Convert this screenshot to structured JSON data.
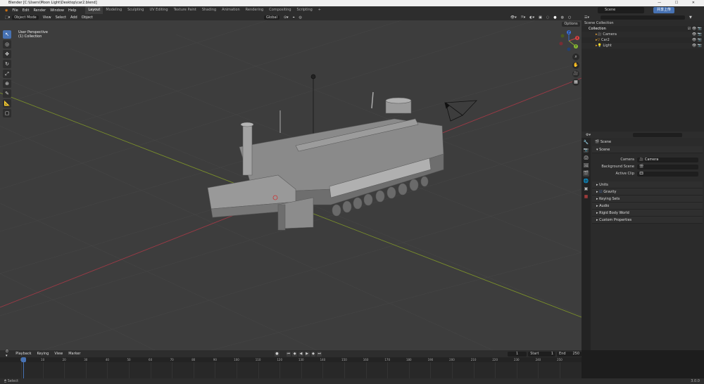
{
  "titlebar": {
    "title": "Blender [C:\\Users\\Moon Light\\Desktop\\car2.blend]"
  },
  "menus": [
    "File",
    "Edit",
    "Render",
    "Window",
    "Help"
  ],
  "workspaces": [
    "Layout",
    "Modeling",
    "Sculpting",
    "UV Editing",
    "Texture Paint",
    "Shading",
    "Animation",
    "Rendering",
    "Compositing",
    "Scripting"
  ],
  "scene_name": "Scene",
  "upload_label": "共享上传",
  "viewport_header": {
    "mode": "Object Mode",
    "menus": [
      "View",
      "Select",
      "Add",
      "Object"
    ],
    "transform": "Global",
    "options": "Options"
  },
  "viewport_info": {
    "line1": "User Perspective",
    "line2": "(1) Collection"
  },
  "gizmo": {
    "x": "X",
    "y": "Y",
    "z": "Z"
  },
  "outliner": {
    "rows": [
      {
        "label": "Scene Collection",
        "indent": 0,
        "vis": ""
      },
      {
        "label": "Collection",
        "indent": 1,
        "vis": "☑ 👁 📷"
      },
      {
        "label": "Camera",
        "indent": 2,
        "vis": "👁 📷"
      },
      {
        "label": "Car2",
        "indent": 2,
        "vis": "👁 📷"
      },
      {
        "label": "Light",
        "indent": 2,
        "vis": "👁 📷"
      }
    ]
  },
  "properties": {
    "context": "Scene",
    "panels": {
      "scene": "Scene",
      "units": "Units",
      "gravity": "Gravity",
      "keying_sets": "Keying Sets",
      "audio": "Audio",
      "rigid_body": "Rigid Body World",
      "custom": "Custom Properties"
    },
    "camera_label": "Camera",
    "camera_value": "Camera",
    "background_label": "Background Scene",
    "active_clip_label": "Active Clip"
  },
  "timeline": {
    "menus": [
      "Playback",
      "Keying",
      "View",
      "Marker"
    ],
    "current_frame": "1",
    "start_label": "Start",
    "start": "1",
    "end_label": "End",
    "end": "250",
    "ticks": [
      0,
      10,
      20,
      30,
      40,
      50,
      60,
      70,
      80,
      90,
      100,
      110,
      120,
      130,
      140,
      150,
      160,
      170,
      180,
      190,
      200,
      210,
      220,
      230,
      240,
      250
    ],
    "playhead_frame": 1
  },
  "status": {
    "left": "Select",
    "right": "3.0.0"
  },
  "colors": {
    "accent": "#4772b3",
    "x_axis": "#9c3a46",
    "y_axis": "#7a8f2b",
    "z_axis": "#3b6fd1"
  }
}
